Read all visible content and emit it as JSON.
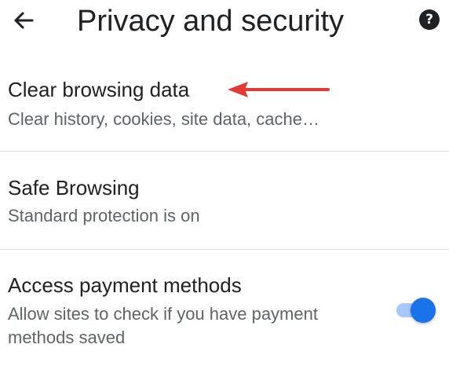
{
  "header": {
    "title": "Privacy and security",
    "back_icon": "arrow-left-icon",
    "help_icon": "help-icon",
    "help_glyph": "?"
  },
  "settings": [
    {
      "title": "Clear browsing data",
      "subtitle": "Clear history, cookies, site data, cache…"
    },
    {
      "title": "Safe Browsing",
      "subtitle": "Standard protection is on"
    },
    {
      "title": "Access payment methods",
      "subtitle": "Allow sites to check if you have payment methods saved",
      "toggle_on": true
    }
  ],
  "annotation": {
    "arrow_color": "#e53935"
  },
  "colors": {
    "toggle_thumb": "#1a73e8",
    "toggle_track": "#a8c7fa",
    "divider": "#dadce0",
    "secondary_text": "#5f6368"
  }
}
